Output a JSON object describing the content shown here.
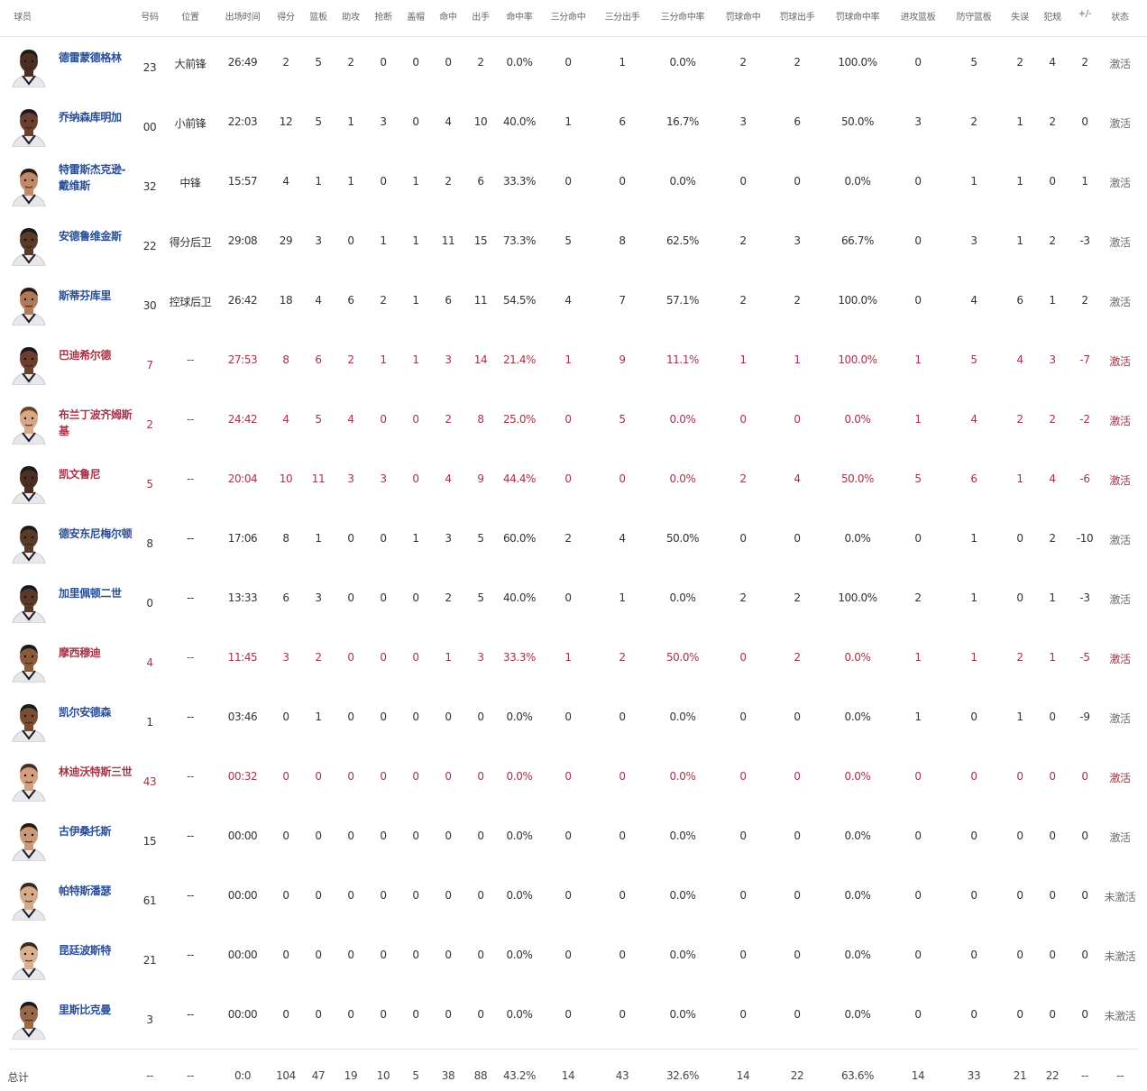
{
  "columns": [
    "球员",
    "号码",
    "位置",
    "出场时间",
    "得分",
    "篮板",
    "助攻",
    "抢断",
    "盖帽",
    "命中",
    "出手",
    "命中率",
    "三分命中",
    "三分出手",
    "三分命中率",
    "罚球命中",
    "罚球出手",
    "罚球命中率",
    "进攻篮板",
    "防守篮板",
    "失误",
    "犯规",
    "+/-",
    "状态"
  ],
  "players": [
    {
      "name": "德雷蒙德格林",
      "num": "23",
      "pos": "大前锋",
      "min": "26:49",
      "pts": "2",
      "reb": "5",
      "ast": "2",
      "stl": "0",
      "blk": "0",
      "fgm": "0",
      "fga": "2",
      "fgp": "0.0%",
      "tpm": "0",
      "tpa": "1",
      "tpp": "0.0%",
      "ftm": "2",
      "fta": "2",
      "ftp": "100.0%",
      "oreb": "0",
      "dreb": "5",
      "tov": "2",
      "pf": "4",
      "pm": "2",
      "status": "激活",
      "highlight": false,
      "skin": "#4a2f22",
      "hair": "#1a1a1a"
    },
    {
      "name": "乔纳森库明加",
      "num": "00",
      "pos": "小前锋",
      "min": "22:03",
      "pts": "12",
      "reb": "5",
      "ast": "1",
      "stl": "3",
      "blk": "0",
      "fgm": "4",
      "fga": "10",
      "fgp": "40.0%",
      "tpm": "1",
      "tpa": "6",
      "tpp": "16.7%",
      "ftm": "3",
      "fta": "6",
      "ftp": "50.0%",
      "oreb": "3",
      "dreb": "2",
      "tov": "1",
      "pf": "2",
      "pm": "0",
      "status": "激活",
      "highlight": false,
      "skin": "#6b4030",
      "hair": "#1a1a1a"
    },
    {
      "name": "特雷斯杰克逊-戴维斯",
      "num": "32",
      "pos": "中锋",
      "min": "15:57",
      "pts": "4",
      "reb": "1",
      "ast": "1",
      "stl": "0",
      "blk": "1",
      "fgm": "2",
      "fga": "6",
      "fgp": "33.3%",
      "tpm": "0",
      "tpa": "0",
      "tpp": "0.0%",
      "ftm": "0",
      "fta": "0",
      "ftp": "0.0%",
      "oreb": "0",
      "dreb": "1",
      "tov": "1",
      "pf": "0",
      "pm": "1",
      "status": "激活",
      "highlight": false,
      "skin": "#c08a6a",
      "hair": "#2a1a10"
    },
    {
      "name": "安德鲁维金斯",
      "num": "22",
      "pos": "得分后卫",
      "min": "29:08",
      "pts": "29",
      "reb": "3",
      "ast": "0",
      "stl": "1",
      "blk": "1",
      "fgm": "11",
      "fga": "15",
      "fgp": "73.3%",
      "tpm": "5",
      "tpa": "8",
      "tpp": "62.5%",
      "ftm": "2",
      "fta": "3",
      "ftp": "66.7%",
      "oreb": "0",
      "dreb": "3",
      "tov": "1",
      "pf": "2",
      "pm": "-3",
      "status": "激活",
      "highlight": false,
      "skin": "#5a3a28",
      "hair": "#1a1a1a"
    },
    {
      "name": "斯蒂芬库里",
      "num": "30",
      "pos": "控球后卫",
      "min": "26:42",
      "pts": "18",
      "reb": "4",
      "ast": "6",
      "stl": "2",
      "blk": "1",
      "fgm": "6",
      "fga": "11",
      "fgp": "54.5%",
      "tpm": "4",
      "tpa": "7",
      "tpp": "57.1%",
      "ftm": "2",
      "fta": "2",
      "ftp": "100.0%",
      "oreb": "0",
      "dreb": "4",
      "tov": "6",
      "pf": "1",
      "pm": "2",
      "status": "激活",
      "highlight": false,
      "skin": "#b07a58",
      "hair": "#2a1a10"
    },
    {
      "name": "巴迪希尔德",
      "num": "7",
      "pos": "--",
      "min": "27:53",
      "pts": "8",
      "reb": "6",
      "ast": "2",
      "stl": "1",
      "blk": "1",
      "fgm": "3",
      "fga": "14",
      "fgp": "21.4%",
      "tpm": "1",
      "tpa": "9",
      "tpp": "11.1%",
      "ftm": "1",
      "fta": "1",
      "ftp": "100.0%",
      "oreb": "1",
      "dreb": "5",
      "tov": "4",
      "pf": "3",
      "pm": "-7",
      "status": "激活",
      "highlight": true,
      "skin": "#6b4030",
      "hair": "#1a1a1a"
    },
    {
      "name": "布兰丁波齐姆斯基",
      "num": "2",
      "pos": "--",
      "min": "24:42",
      "pts": "4",
      "reb": "5",
      "ast": "4",
      "stl": "0",
      "blk": "0",
      "fgm": "2",
      "fga": "8",
      "fgp": "25.0%",
      "tpm": "0",
      "tpa": "5",
      "tpp": "0.0%",
      "ftm": "0",
      "fta": "0",
      "ftp": "0.0%",
      "oreb": "1",
      "dreb": "4",
      "tov": "2",
      "pf": "2",
      "pm": "-2",
      "status": "激活",
      "highlight": true,
      "skin": "#d6a888",
      "hair": "#6a4428"
    },
    {
      "name": "凯文鲁尼",
      "num": "5",
      "pos": "--",
      "min": "20:04",
      "pts": "10",
      "reb": "11",
      "ast": "3",
      "stl": "3",
      "blk": "0",
      "fgm": "4",
      "fga": "9",
      "fgp": "44.4%",
      "tpm": "0",
      "tpa": "0",
      "tpp": "0.0%",
      "ftm": "2",
      "fta": "4",
      "ftp": "50.0%",
      "oreb": "5",
      "dreb": "6",
      "tov": "1",
      "pf": "4",
      "pm": "-6",
      "status": "激活",
      "highlight": true,
      "skin": "#4a2f22",
      "hair": "#1a1a1a"
    },
    {
      "name": "德安东尼梅尔顿",
      "num": "8",
      "pos": "--",
      "min": "17:06",
      "pts": "8",
      "reb": "1",
      "ast": "0",
      "stl": "0",
      "blk": "1",
      "fgm": "3",
      "fga": "5",
      "fgp": "60.0%",
      "tpm": "2",
      "tpa": "4",
      "tpp": "50.0%",
      "ftm": "0",
      "fta": "0",
      "ftp": "0.0%",
      "oreb": "0",
      "dreb": "1",
      "tov": "0",
      "pf": "2",
      "pm": "-10",
      "status": "激活",
      "highlight": false,
      "skin": "#5a3a28",
      "hair": "#1a1a1a"
    },
    {
      "name": "加里佩顿二世",
      "num": "0",
      "pos": "--",
      "min": "13:33",
      "pts": "6",
      "reb": "3",
      "ast": "0",
      "stl": "0",
      "blk": "0",
      "fgm": "2",
      "fga": "5",
      "fgp": "40.0%",
      "tpm": "0",
      "tpa": "1",
      "tpp": "0.0%",
      "ftm": "2",
      "fta": "2",
      "ftp": "100.0%",
      "oreb": "2",
      "dreb": "1",
      "tov": "0",
      "pf": "1",
      "pm": "-3",
      "status": "激活",
      "highlight": false,
      "skin": "#5a3a28",
      "hair": "#1a1a1a"
    },
    {
      "name": "摩西穆迪",
      "num": "4",
      "pos": "--",
      "min": "11:45",
      "pts": "3",
      "reb": "2",
      "ast": "0",
      "stl": "0",
      "blk": "0",
      "fgm": "1",
      "fga": "3",
      "fgp": "33.3%",
      "tpm": "1",
      "tpa": "2",
      "tpp": "50.0%",
      "ftm": "0",
      "fta": "2",
      "ftp": "0.0%",
      "oreb": "1",
      "dreb": "1",
      "tov": "2",
      "pf": "1",
      "pm": "-5",
      "status": "激活",
      "highlight": true,
      "skin": "#8a5a3a",
      "hair": "#1a1a1a"
    },
    {
      "name": "凯尔安德森",
      "num": "1",
      "pos": "--",
      "min": "03:46",
      "pts": "0",
      "reb": "1",
      "ast": "0",
      "stl": "0",
      "blk": "0",
      "fgm": "0",
      "fga": "0",
      "fgp": "0.0%",
      "tpm": "0",
      "tpa": "0",
      "tpp": "0.0%",
      "ftm": "0",
      "fta": "0",
      "ftp": "0.0%",
      "oreb": "1",
      "dreb": "0",
      "tov": "1",
      "pf": "0",
      "pm": "-9",
      "status": "激活",
      "highlight": false,
      "skin": "#7a4c32",
      "hair": "#1a1a1a"
    },
    {
      "name": "林迪沃特斯三世",
      "num": "43",
      "pos": "--",
      "min": "00:32",
      "pts": "0",
      "reb": "0",
      "ast": "0",
      "stl": "0",
      "blk": "0",
      "fgm": "0",
      "fga": "0",
      "fgp": "0.0%",
      "tpm": "0",
      "tpa": "0",
      "tpp": "0.0%",
      "ftm": "0",
      "fta": "0",
      "ftp": "0.0%",
      "oreb": "0",
      "dreb": "0",
      "tov": "0",
      "pf": "0",
      "pm": "0",
      "status": "激活",
      "highlight": true,
      "skin": "#d0a080",
      "hair": "#4a3020"
    },
    {
      "name": "古伊桑托斯",
      "num": "15",
      "pos": "--",
      "min": "00:00",
      "pts": "0",
      "reb": "0",
      "ast": "0",
      "stl": "0",
      "blk": "0",
      "fgm": "0",
      "fga": "0",
      "fgp": "0.0%",
      "tpm": "0",
      "tpa": "0",
      "tpp": "0.0%",
      "ftm": "0",
      "fta": "0",
      "ftp": "0.0%",
      "oreb": "0",
      "dreb": "0",
      "tov": "0",
      "pf": "0",
      "pm": "0",
      "status": "激活",
      "highlight": false,
      "skin": "#c89878",
      "hair": "#2a1a10"
    },
    {
      "name": "帕特斯潘瑟",
      "num": "61",
      "pos": "--",
      "min": "00:00",
      "pts": "0",
      "reb": "0",
      "ast": "0",
      "stl": "0",
      "blk": "0",
      "fgm": "0",
      "fga": "0",
      "fgp": "0.0%",
      "tpm": "0",
      "tpa": "0",
      "tpp": "0.0%",
      "ftm": "0",
      "fta": "0",
      "ftp": "0.0%",
      "oreb": "0",
      "dreb": "0",
      "tov": "0",
      "pf": "0",
      "pm": "0",
      "status": "未激活",
      "highlight": false,
      "skin": "#d4aa8a",
      "hair": "#3a2a1a"
    },
    {
      "name": "昆廷波斯特",
      "num": "21",
      "pos": "--",
      "min": "00:00",
      "pts": "0",
      "reb": "0",
      "ast": "0",
      "stl": "0",
      "blk": "0",
      "fgm": "0",
      "fga": "0",
      "fgp": "0.0%",
      "tpm": "0",
      "tpa": "0",
      "tpp": "0.0%",
      "ftm": "0",
      "fta": "0",
      "ftp": "0.0%",
      "oreb": "0",
      "dreb": "0",
      "tov": "0",
      "pf": "0",
      "pm": "0",
      "status": "未激活",
      "highlight": false,
      "skin": "#d8b090",
      "hair": "#3a2a1a"
    },
    {
      "name": "里斯比克曼",
      "num": "3",
      "pos": "--",
      "min": "00:00",
      "pts": "0",
      "reb": "0",
      "ast": "0",
      "stl": "0",
      "blk": "0",
      "fgm": "0",
      "fga": "0",
      "fgp": "0.0%",
      "tpm": "0",
      "tpa": "0",
      "tpp": "0.0%",
      "ftm": "0",
      "fta": "0",
      "ftp": "0.0%",
      "oreb": "0",
      "dreb": "0",
      "tov": "0",
      "pf": "0",
      "pm": "0",
      "status": "未激活",
      "highlight": false,
      "skin": "#9a6a48",
      "hair": "#1a1a1a"
    }
  ],
  "totals": {
    "label": "总计",
    "num": "--",
    "pos": "--",
    "min": "0:0",
    "pts": "104",
    "reb": "47",
    "ast": "19",
    "stl": "10",
    "blk": "5",
    "fgm": "38",
    "fga": "88",
    "fgp": "43.2%",
    "tpm": "14",
    "tpa": "43",
    "tpp": "32.6%",
    "ftm": "14",
    "fta": "22",
    "ftp": "63.6%",
    "oreb": "14",
    "dreb": "33",
    "tov": "21",
    "pf": "22",
    "pm": "--",
    "status": "--"
  },
  "colors": {
    "name": "#2a4e97",
    "highlight": "#a43447",
    "text": "#333333",
    "border": "#e4e8ee"
  }
}
